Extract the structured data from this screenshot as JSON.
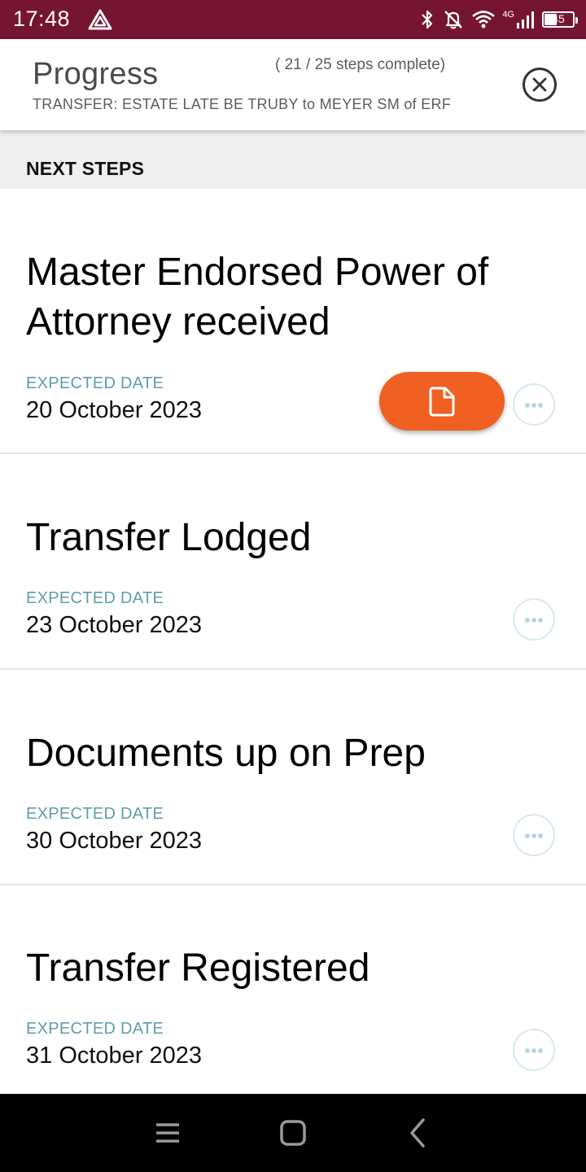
{
  "status_bar": {
    "time": "17:48",
    "battery": "45",
    "network_label": "4G",
    "icons": [
      "warning-triangle-icon",
      "bluetooth-icon",
      "notifications-off-icon",
      "wifi-icon",
      "signal-icon",
      "battery-icon"
    ]
  },
  "header": {
    "title": "Progress",
    "count": "( 21 / 25 steps complete)",
    "subtitle": "TRANSFER: ESTATE LATE BE TRUBY to MEYER SM of ERF"
  },
  "section": {
    "title": "NEXT STEPS"
  },
  "steps": [
    {
      "title": "Master Endorsed Power of Attorney received",
      "date_label": "EXPECTED DATE",
      "date": "20 October 2023",
      "has_document": true
    },
    {
      "title": "Transfer Lodged",
      "date_label": "EXPECTED DATE",
      "date": "23 October 2023",
      "has_document": false
    },
    {
      "title": "Documents up on Prep",
      "date_label": "EXPECTED DATE",
      "date": "30 October 2023",
      "has_document": false
    },
    {
      "title": "Transfer Registered",
      "date_label": "EXPECTED DATE",
      "date": "31 October 2023",
      "has_document": false
    }
  ],
  "colors": {
    "status_bar": "#751532",
    "accent": "#f06022",
    "date_label": "#5e9ea6"
  },
  "nav_icons": [
    "menu-icon",
    "home-icon",
    "back-icon"
  ]
}
